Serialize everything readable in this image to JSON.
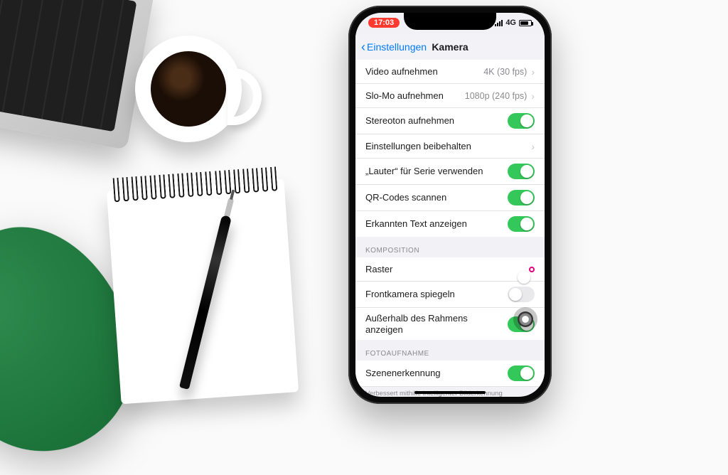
{
  "statusbar": {
    "time": "17:03",
    "network": "4G"
  },
  "nav": {
    "back_label": "Einstellungen",
    "title": "Kamera"
  },
  "section1": {
    "video_label": "Video aufnehmen",
    "video_value": "4K (30 fps)",
    "slomo_label": "Slo-Mo aufnehmen",
    "slomo_value": "1080p (240 fps)",
    "stereo_label": "Stereoton aufnehmen",
    "preserve_label": "Einstellungen beibehalten",
    "louder_label": "„Lauter“ für Serie verwenden",
    "qr_label": "QR-Codes scannen",
    "text_label": "Erkannten Text anzeigen"
  },
  "composition": {
    "header": "KOMPOSITION",
    "grid_label": "Raster",
    "mirror_label": "Frontkamera spiegeln",
    "outside_label": "Außerhalb des Rahmens anzeigen"
  },
  "photocapture": {
    "header": "FOTOAUFNAHME",
    "scene_label": "Szenenerkennung",
    "scene_footer": "Verbessert mithilfe intelligenter Bilderkennung automatisch Fotos mit verschiedenen Szenen."
  },
  "toggles": {
    "stereo": true,
    "louder": true,
    "qr": true,
    "text": true,
    "grid": true,
    "mirror": false,
    "outside": true,
    "scene": true
  }
}
